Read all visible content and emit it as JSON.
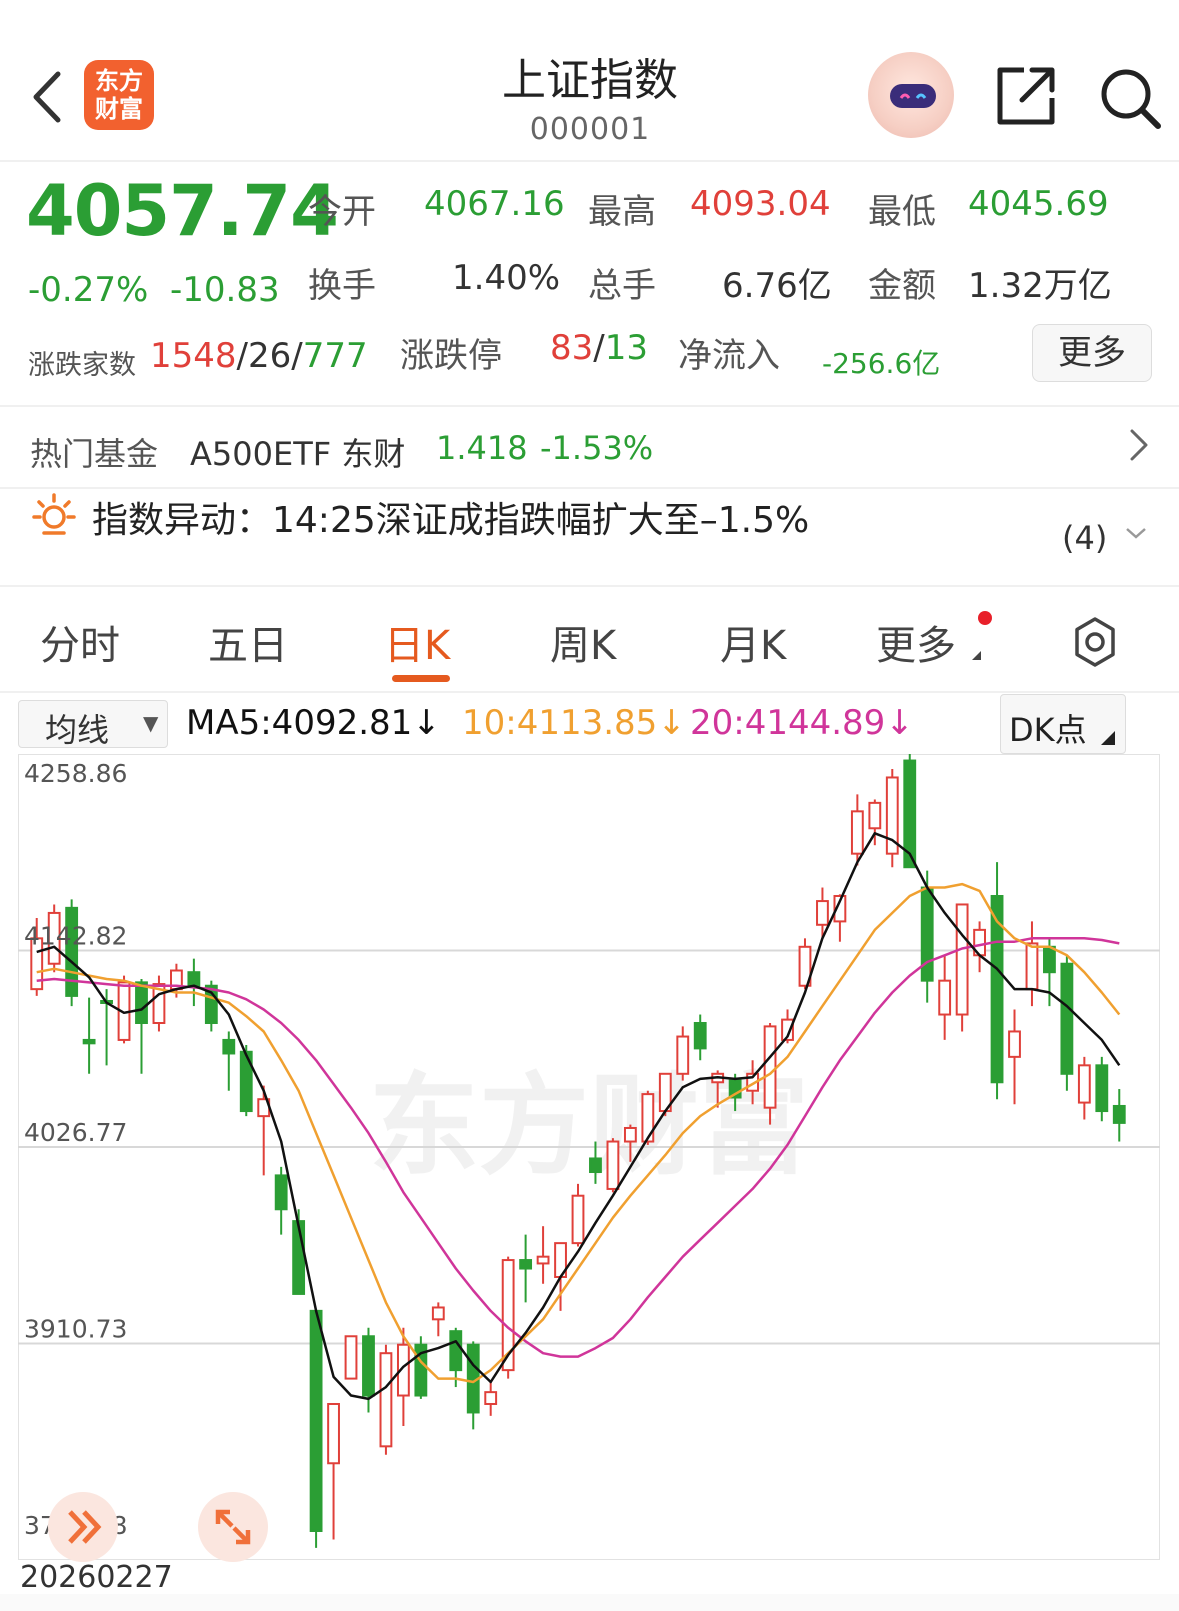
{
  "header": {
    "back_icon": "chevron-left-icon",
    "logo_text_line1": "东方",
    "logo_text_line2": "财富",
    "title": "上证指数",
    "code": "000001",
    "avatar_icon": "robot-assistant-icon",
    "share_icon": "share-icon",
    "search_icon": "search-icon"
  },
  "quote": {
    "price": "4057.74",
    "change_pct": "-0.27%",
    "change": "-10.83",
    "open_label": "今开",
    "open": "4067.16",
    "high_label": "最高",
    "high": "4093.04",
    "low_label": "最低",
    "low": "4045.69",
    "turnover_label": "换手",
    "turnover": "1.40%",
    "volume_label": "总手",
    "volume": "6.76亿",
    "amount_label": "金额",
    "amount": "1.32万亿",
    "breadth_label": "涨跌家数",
    "breadth_up": "1548",
    "breadth_flat": "26",
    "breadth_down": "777",
    "limit_label": "涨跌停",
    "limit_up": "83",
    "limit_down": "13",
    "netflow_label": "净流入",
    "netflow": "-256.6亿",
    "more_label": "更多"
  },
  "hot_fund": {
    "label": "热门基金",
    "name": "A500ETF 东财",
    "price": "1.418",
    "change": "-1.53%"
  },
  "alert": {
    "icon": "sun-alert-icon",
    "text": "指数异动：14:25深证成指跌幅扩大至–1.5%",
    "count": "(4)"
  },
  "tabs": [
    "分时",
    "五日",
    "日K",
    "周K",
    "月K",
    "更多"
  ],
  "active_tab": "日K",
  "ma": {
    "select_label": "均线",
    "ma5": "MA5:4092.81↓",
    "ma10": "10:4113.85↓",
    "ma20": "20:4144.89↓",
    "dk_label": "DK点"
  },
  "colors": {
    "up": "#e0403a",
    "down": "#2b9e34",
    "ma5": "#111111",
    "ma10": "#f0a030",
    "ma20": "#d0359a",
    "accent": "#e55a1f"
  },
  "chart_data": {
    "type": "candlestick",
    "y_ticks": [
      "4258.86",
      "4142.82",
      "4026.77",
      "3910.73",
      "3794.68"
    ],
    "ylim": [
      3794.68,
      4258.86
    ],
    "start_date": "20260227",
    "watermark": "东方财富",
    "candles": [
      {
        "o": 4120,
        "h": 4162,
        "l": 4116,
        "c": 4150
      },
      {
        "o": 4135,
        "h": 4170,
        "l": 4130,
        "c": 4165
      },
      {
        "o": 4168,
        "h": 4173,
        "l": 4110,
        "c": 4116
      },
      {
        "o": 4090,
        "h": 4115,
        "l": 4070,
        "c": 4088
      },
      {
        "o": 4113,
        "h": 4120,
        "l": 4075,
        "c": 4112
      },
      {
        "o": 4090,
        "h": 4128,
        "l": 4088,
        "c": 4124
      },
      {
        "o": 4124,
        "h": 4126,
        "l": 4070,
        "c": 4100
      },
      {
        "o": 4100,
        "h": 4128,
        "l": 4095,
        "c": 4123
      },
      {
        "o": 4120,
        "h": 4135,
        "l": 4115,
        "c": 4131
      },
      {
        "o": 4130,
        "h": 4138,
        "l": 4110,
        "c": 4122
      },
      {
        "o": 4122,
        "h": 4125,
        "l": 4095,
        "c": 4100
      },
      {
        "o": 4090,
        "h": 4095,
        "l": 4060,
        "c": 4082
      },
      {
        "o": 4083,
        "h": 4087,
        "l": 4045,
        "c": 4048
      },
      {
        "o": 4045,
        "h": 4063,
        "l": 4010,
        "c": 4055
      },
      {
        "o": 4010,
        "h": 4015,
        "l": 3975,
        "c": 3990
      },
      {
        "o": 3983,
        "h": 3990,
        "l": 3940,
        "c": 3940
      },
      {
        "o": 3930,
        "h": 3930,
        "l": 3790,
        "c": 3800
      },
      {
        "o": 3840,
        "h": 3870,
        "l": 3795,
        "c": 3875
      },
      {
        "o": 3890,
        "h": 3915,
        "l": 3890,
        "c": 3915
      },
      {
        "o": 3915,
        "h": 3920,
        "l": 3870,
        "c": 3880
      },
      {
        "o": 3850,
        "h": 3910,
        "l": 3845,
        "c": 3905
      },
      {
        "o": 3880,
        "h": 3920,
        "l": 3862,
        "c": 3910
      },
      {
        "o": 3910,
        "h": 3915,
        "l": 3878,
        "c": 3880
      },
      {
        "o": 3925,
        "h": 3935,
        "l": 3915,
        "c": 3932
      },
      {
        "o": 3918,
        "h": 3920,
        "l": 3885,
        "c": 3895
      },
      {
        "o": 3910,
        "h": 3912,
        "l": 3860,
        "c": 3870
      },
      {
        "o": 3875,
        "h": 3888,
        "l": 3868,
        "c": 3882
      },
      {
        "o": 3895,
        "h": 3962,
        "l": 3890,
        "c": 3960
      },
      {
        "o": 3960,
        "h": 3975,
        "l": 3935,
        "c": 3955
      },
      {
        "o": 3958,
        "h": 3980,
        "l": 3946,
        "c": 3962
      },
      {
        "o": 3950,
        "h": 3967,
        "l": 3930,
        "c": 3970
      },
      {
        "o": 3970,
        "h": 4005,
        "l": 3968,
        "c": 3998
      },
      {
        "o": 4020,
        "h": 4030,
        "l": 4005,
        "c": 4012
      },
      {
        "o": 4002,
        "h": 4032,
        "l": 4000,
        "c": 4030
      },
      {
        "o": 4030,
        "h": 4040,
        "l": 4018,
        "c": 4038
      },
      {
        "o": 4030,
        "h": 4060,
        "l": 4028,
        "c": 4058
      },
      {
        "o": 4048,
        "h": 4070,
        "l": 4045,
        "c": 4070
      },
      {
        "o": 4070,
        "h": 4098,
        "l": 4066,
        "c": 4092
      },
      {
        "o": 4100,
        "h": 4105,
        "l": 4078,
        "c": 4085
      },
      {
        "o": 4065,
        "h": 4072,
        "l": 4050,
        "c": 4070
      },
      {
        "o": 4066,
        "h": 4070,
        "l": 4048,
        "c": 4056
      },
      {
        "o": 4060,
        "h": 4078,
        "l": 4052,
        "c": 4070
      },
      {
        "o": 4050,
        "h": 4100,
        "l": 4040,
        "c": 4098
      },
      {
        "o": 4090,
        "h": 4108,
        "l": 4088,
        "c": 4102
      },
      {
        "o": 4122,
        "h": 4150,
        "l": 4120,
        "c": 4145
      },
      {
        "o": 4158,
        "h": 4180,
        "l": 4150,
        "c": 4172
      },
      {
        "o": 4160,
        "h": 4176,
        "l": 4148,
        "c": 4175
      },
      {
        "o": 4200,
        "h": 4235,
        "l": 4193,
        "c": 4225
      },
      {
        "o": 4215,
        "h": 4232,
        "l": 4205,
        "c": 4230
      },
      {
        "o": 4200,
        "h": 4250,
        "l": 4192,
        "c": 4245
      },
      {
        "o": 4255,
        "h": 4259,
        "l": 4192,
        "c": 4192
      },
      {
        "o": 4180,
        "h": 4190,
        "l": 4112,
        "c": 4125
      },
      {
        "o": 4105,
        "h": 4140,
        "l": 4090,
        "c": 4125
      },
      {
        "o": 4105,
        "h": 4170,
        "l": 4095,
        "c": 4170
      },
      {
        "o": 4140,
        "h": 4160,
        "l": 4130,
        "c": 4155
      },
      {
        "o": 4175,
        "h": 4195,
        "l": 4055,
        "c": 4065
      },
      {
        "o": 4080,
        "h": 4108,
        "l": 4052,
        "c": 4095
      },
      {
        "o": 4120,
        "h": 4160,
        "l": 4110,
        "c": 4147
      },
      {
        "o": 4145,
        "h": 4150,
        "l": 4110,
        "c": 4130
      },
      {
        "o": 4135,
        "h": 4140,
        "l": 4060,
        "c": 4070
      },
      {
        "o": 4053,
        "h": 4080,
        "l": 4043,
        "c": 4075
      },
      {
        "o": 4075,
        "h": 4080,
        "l": 4042,
        "c": 4048
      },
      {
        "o": 4051,
        "h": 4061,
        "l": 4030,
        "c": 4041
      }
    ],
    "ma5_line": [
      4142,
      4145,
      4136,
      4127,
      4112,
      4106,
      4108,
      4117,
      4120,
      4122,
      4118,
      4105,
      4081,
      4060,
      4030,
      3980,
      3930,
      3891,
      3880,
      3878,
      3885,
      3897,
      3905,
      3908,
      3912,
      3898,
      3888,
      3904,
      3917,
      3932,
      3950,
      3965,
      3982,
      3998,
      4015,
      4032,
      4048,
      4062,
      4067,
      4068,
      4067,
      4068,
      4080,
      4092,
      4118,
      4150,
      4172,
      4195,
      4212,
      4208,
      4200,
      4180,
      4165,
      4152,
      4140,
      4132,
      4120,
      4120,
      4118,
      4110,
      4100,
      4090,
      4075
    ],
    "ma10_line": [
      4130,
      4132,
      4130,
      4128,
      4126,
      4125,
      4122,
      4120,
      4118,
      4118,
      4115,
      4112,
      4104,
      4095,
      4078,
      4060,
      4035,
      4010,
      3985,
      3960,
      3935,
      3915,
      3900,
      3890,
      3890,
      3888,
      3895,
      3905,
      3915,
      3925,
      3940,
      3955,
      3970,
      3985,
      3998,
      4010,
      4022,
      4035,
      4045,
      4052,
      4058,
      4064,
      4070,
      4080,
      4095,
      4110,
      4125,
      4140,
      4155,
      4165,
      4175,
      4180,
      4180,
      4182,
      4178,
      4160,
      4150,
      4145,
      4145,
      4140,
      4130,
      4118,
      4105
    ],
    "ma20_line": [
      4125,
      4126,
      4125,
      4124,
      4123,
      4122,
      4122,
      4122,
      4122,
      4121,
      4120,
      4118,
      4114,
      4108,
      4100,
      4090,
      4078,
      4064,
      4050,
      4035,
      4018,
      4000,
      3985,
      3970,
      3955,
      3942,
      3930,
      3920,
      3912,
      3905,
      3903,
      3903,
      3908,
      3914,
      3925,
      3938,
      3950,
      3962,
      3972,
      3982,
      3992,
      4002,
      4014,
      4028,
      4045,
      4062,
      4078,
      4092,
      4106,
      4118,
      4128,
      4136,
      4140,
      4144,
      4146,
      4148,
      4148,
      4150,
      4150,
      4150,
      4150,
      4149,
      4147
    ]
  },
  "chart_controls": {
    "collapse_icon": "double-chevron-icon",
    "expand_icon": "expand-arrows-icon"
  }
}
